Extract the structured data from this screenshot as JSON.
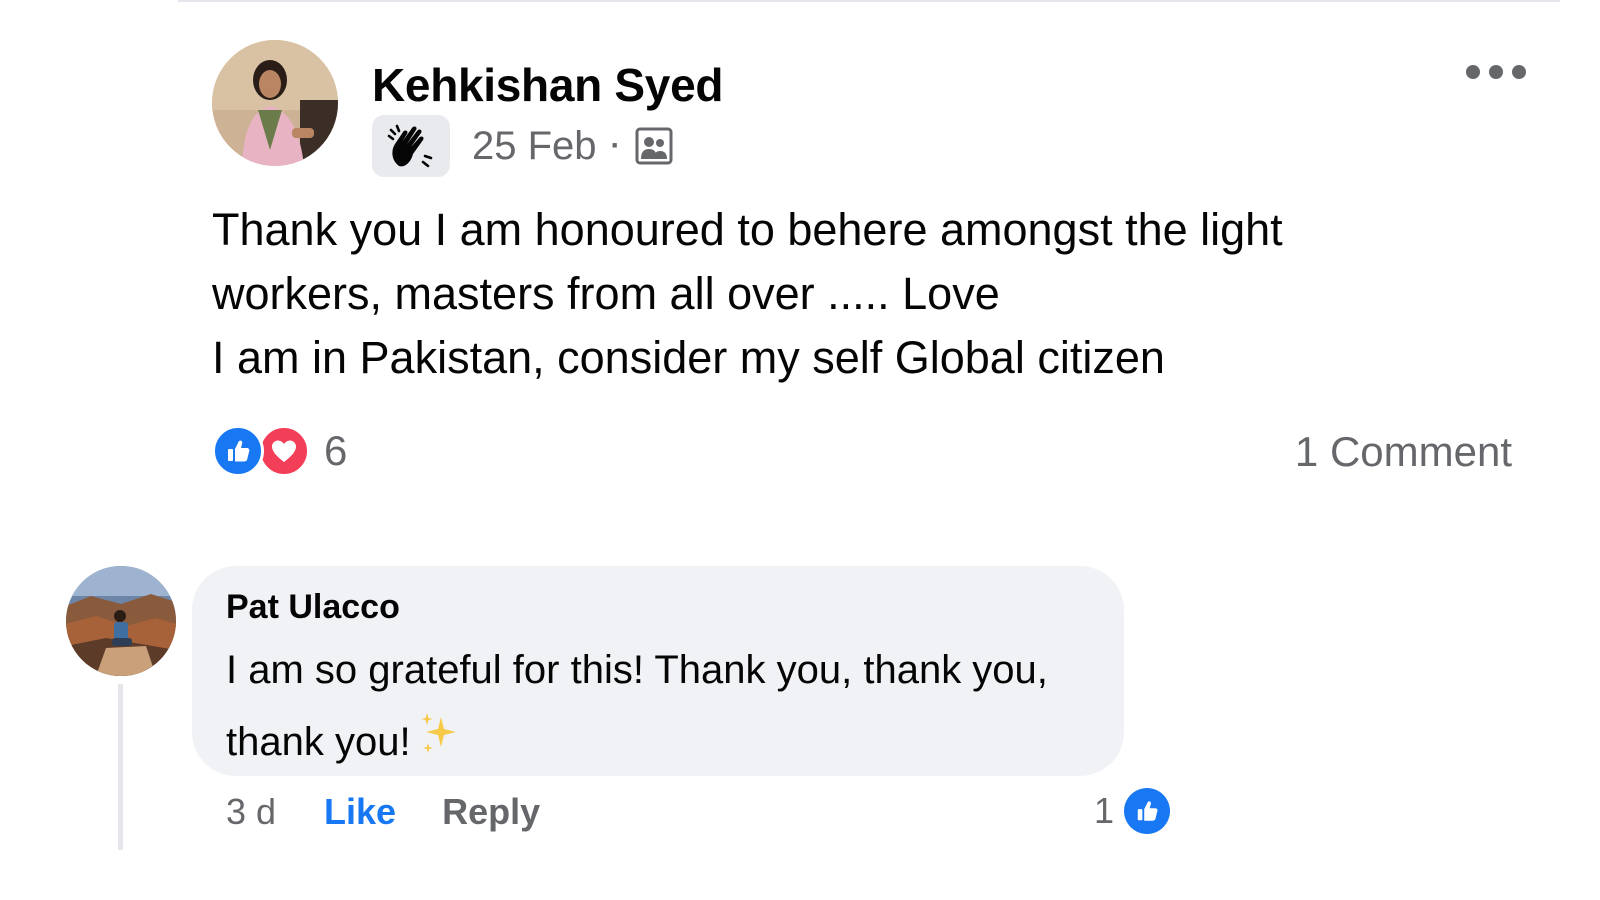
{
  "colors": {
    "accent": "#1877f2",
    "love": "#f33e58",
    "secondary_text": "#65676b",
    "bubble_background": "#f0f2f5"
  },
  "post": {
    "author": "Kehkishan Syed",
    "badge_icon": "waving-hand-icon",
    "date": "25 Feb",
    "separator": "·",
    "audience_icon": "group-photo-icon",
    "more_icon": "more-options-icon",
    "text_lines": [
      "Thank you I am honoured to behere amongst the light",
      "workers, masters from all over ..... Love",
      "I am in Pakistan, consider my self Global citizen"
    ],
    "reactions": {
      "types": [
        "like-icon",
        "love-icon"
      ],
      "count": "6"
    },
    "comment_count": "1 Comment"
  },
  "comment": {
    "author": "Pat Ulacco",
    "text": "I am so grateful for this! Thank you, thank you, thank you!",
    "emoji": "sparkles-icon",
    "time": "3 d",
    "like_label": "Like",
    "reply_label": "Reply",
    "reaction_count": "1"
  }
}
